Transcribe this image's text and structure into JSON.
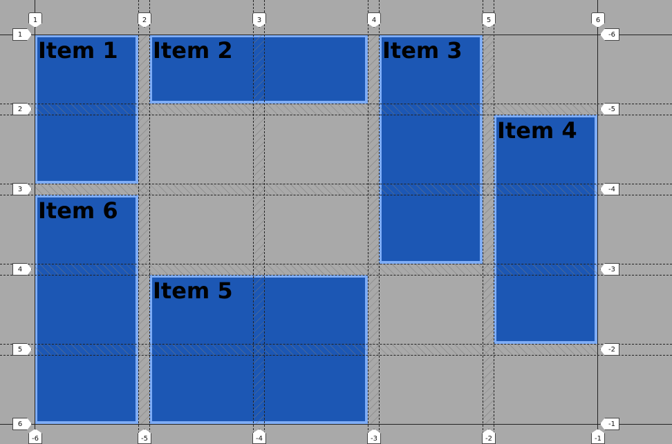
{
  "grid": {
    "items": [
      {
        "label": "Item 1",
        "column": "1 / 2",
        "row": "1 / 3"
      },
      {
        "label": "Item 2",
        "column": "2 / 4",
        "row": "1 / 2"
      },
      {
        "label": "Item 3",
        "column": "4 / 5",
        "row": "1 / 4"
      },
      {
        "label": "Item 4",
        "column": "5 / 6",
        "row": "2 / 5"
      },
      {
        "label": "Item 5",
        "column": "2 / 4",
        "row": "4 / 6"
      },
      {
        "label": "Item 6",
        "column": "1 / 2",
        "row": "3 / 6"
      }
    ],
    "column_labels_top": [
      "1",
      "2",
      "3",
      "4",
      "5",
      "6"
    ],
    "column_labels_bottom": [
      "-6",
      "-5",
      "-4",
      "-3",
      "-2",
      "-1"
    ],
    "row_labels_left": [
      "1",
      "2",
      "3",
      "4",
      "5",
      "6"
    ],
    "row_labels_right": [
      "-6",
      "-5",
      "-4",
      "-3",
      "-2",
      "-1"
    ],
    "colors": {
      "item_fill": "#1c57b4",
      "item_border": "#7fadf6",
      "background": "#a9a9a9"
    }
  }
}
